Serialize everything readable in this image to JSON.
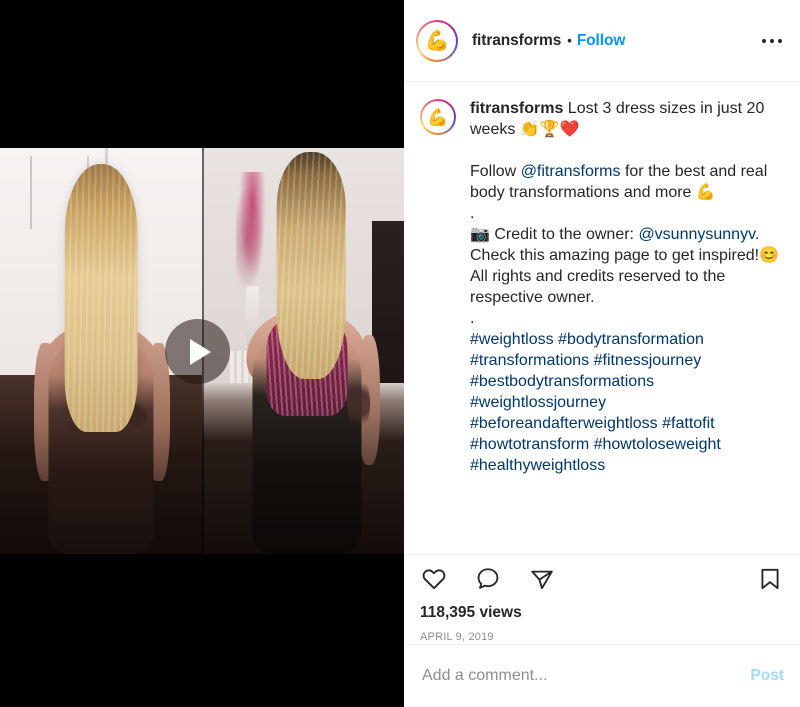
{
  "header": {
    "username": "fitransforms",
    "separator": "•",
    "follow_label": "Follow",
    "avatar_emoji": "💪",
    "more_icon": "more-options-icon"
  },
  "caption": {
    "username": "fitransforms",
    "first_line": " Lost 3 dress sizes in just 20 weeks 👏🏆❤️",
    "paragraphs": [
      "Follow @fitransforms for the best and real body transformations and more 💪",
      ".",
      "📷 Credit to the owner: @vsunnysunnyv. Check this amazing page to get inspired!😊 All rights and credits reserved to the respective owner.",
      "."
    ],
    "mention_1": "@fitransforms",
    "mention_2": "@vsunnysunnyv",
    "hashtags": "#weightloss #bodytransformation #transformations #fitnessjourney #bestbodytransformations #weightlossjourney #beforeandafterweightloss  #fattofit #howtotransform #howtoloseweight #healthyweightloss"
  },
  "actions": {
    "like_icon": "heart-icon",
    "comment_icon": "comment-bubble-icon",
    "share_icon": "share-paper-plane-icon",
    "save_icon": "bookmark-icon"
  },
  "stats": {
    "views": "118,395 views",
    "date": "APRIL 9, 2019"
  },
  "comment_form": {
    "placeholder": "Add a comment...",
    "value": "",
    "post_label": "Post"
  },
  "media": {
    "type": "video",
    "play_icon": "play-icon",
    "description": "before-and-after body transformation split video"
  },
  "colors": {
    "link_blue": "#0095f6",
    "hashtag_blue": "#00376b",
    "text_primary": "#262626",
    "text_secondary": "#8e8e8e",
    "divider": "#efefef",
    "letterbox": "#000000"
  }
}
